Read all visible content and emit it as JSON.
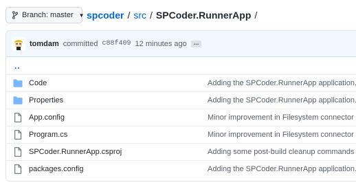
{
  "branch": {
    "label": "Branch:",
    "value": "master"
  },
  "breadcrumb": {
    "repo": "spcoder",
    "folder": "src",
    "current": "SPCoder.RunnerApp",
    "separator": "/"
  },
  "commit": {
    "author": "tomdam",
    "action": "committed",
    "sha": "c88f409",
    "time": "12 minutes ago",
    "more": "..."
  },
  "parent_link": "..",
  "files": [
    {
      "type": "folder",
      "name": "Code",
      "message": "Adding the SPCoder.RunnerApp application."
    },
    {
      "type": "folder",
      "name": "Properties",
      "message": "Adding the SPCoder.RunnerApp application."
    },
    {
      "type": "file",
      "name": "App.config",
      "message": "Minor improvement in Filesystem connector related"
    },
    {
      "type": "file",
      "name": "Program.cs",
      "message": "Minor improvement in Filesystem connector related"
    },
    {
      "type": "file",
      "name": "SPCoder.RunnerApp.csproj",
      "message": "Adding some post-build cleanup commands"
    },
    {
      "type": "file",
      "name": "packages.config",
      "message": "Adding the SPCoder.RunnerApp application."
    }
  ],
  "colors": {
    "link": "#0366d6",
    "folder": "#79b8ff",
    "commit_bar": "#f1f8ff"
  }
}
